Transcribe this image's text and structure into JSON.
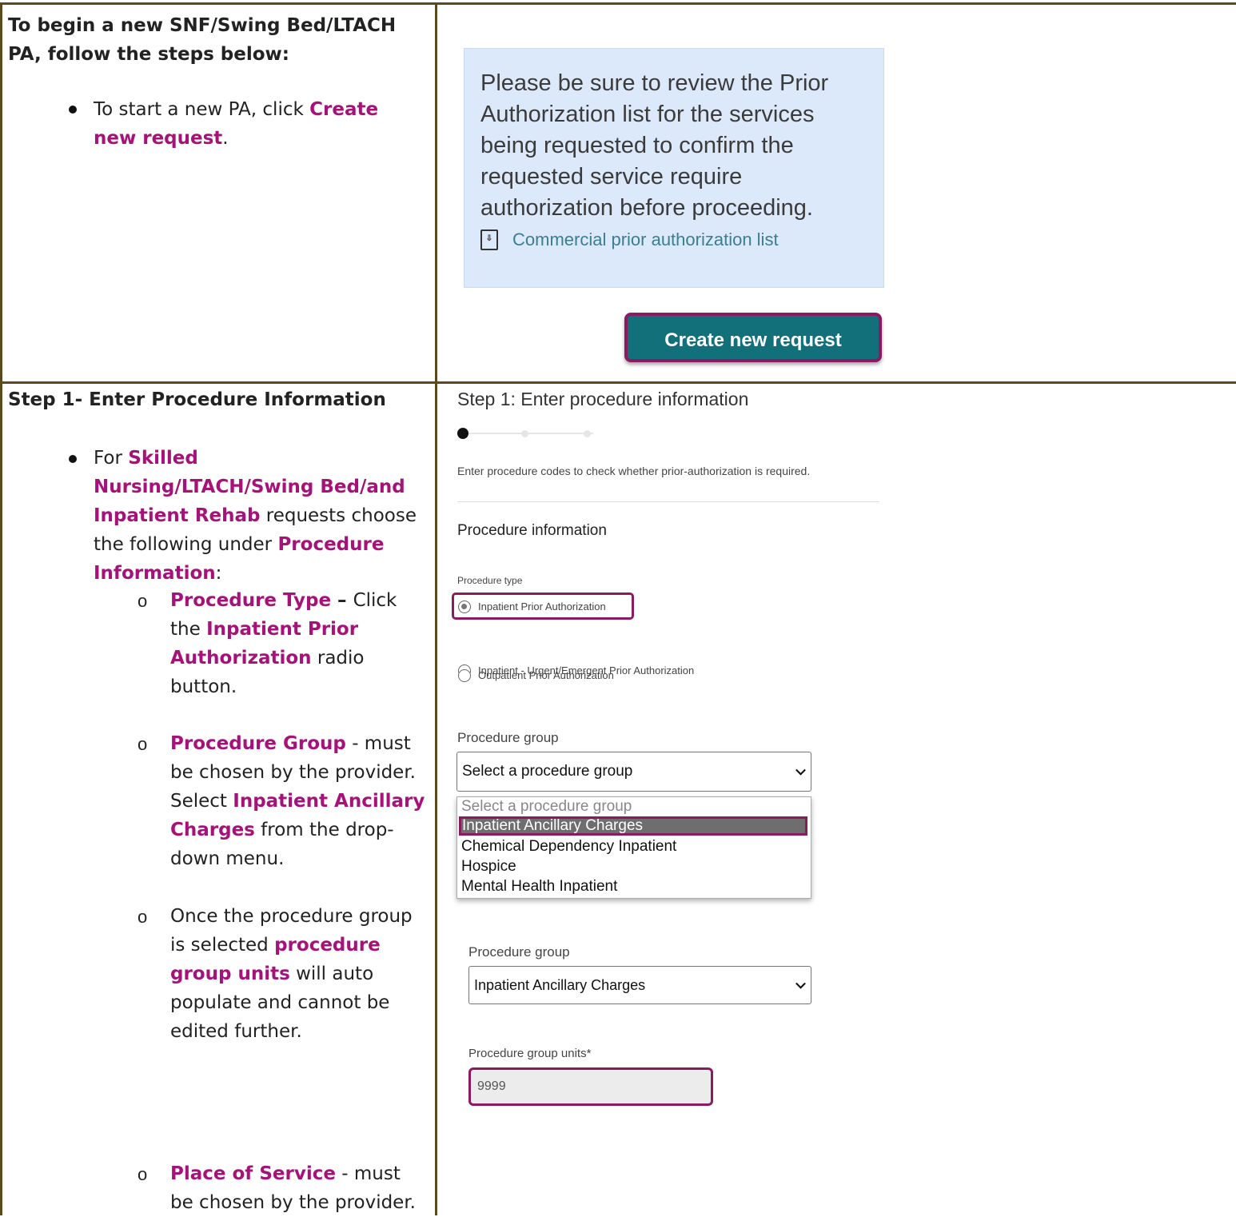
{
  "row1": {
    "heading": "To begin a new SNF/Swing Bed/LTACH PA, follow the steps below:",
    "bullet_text_pre": "To start a new PA, click ",
    "bullet_link": "Create new request",
    "bullet_text_post": "."
  },
  "notice": {
    "text": "Please be sure to review the Prior Authorization list for the services being requested to confirm the requested service require authorization before proceeding.",
    "link_label": "Commercial prior authorization list",
    "link_icon": "pdf-icon"
  },
  "create_button": {
    "label": "Create new request"
  },
  "row2": {
    "heading": "Step 1- Enter Procedure Information",
    "b1_pre": "For ",
    "b1_mag": "Skilled Nursing/LTACH/Swing Bed/and Inpatient Rehab",
    "b1_mid": " requests choose the following under ",
    "b1_mag2": "Procedure Information",
    "b1_post": ":",
    "s1_mag": "Procedure Type",
    "s1_dash": " – ",
    "s1_t1": "Click the ",
    "s1_mag2": "Inpatient Prior Authorization",
    "s1_t2": " radio button.",
    "s2_mag": "Procedure Group",
    "s2_t1": " - must be chosen by the provider. Select ",
    "s2_mag2": "Inpatient Ancillary Charges",
    "s2_t2": " from the drop-down menu.",
    "s3_t1": "Once the procedure group is selected ",
    "s3_mag": "procedure group units",
    "s3_t2": " will auto populate and cannot be edited further.",
    "s4_mag": "Place of Service",
    "s4_t1": " - must be chosen by the provider."
  },
  "step1": {
    "title": "Step 1: Enter procedure information",
    "help": "Enter procedure codes to check whether prior-authorization is required.",
    "section": "Procedure information",
    "type_label": "Procedure type",
    "radio_options": [
      "Inpatient Prior Authorization",
      "Inpatient - Urgent/Emergent Prior Authorization",
      "Outpatient Prior Authorization"
    ],
    "radio_selected": "Inpatient Prior Authorization",
    "group_label": "Procedure group",
    "group_placeholder": "Select a procedure group",
    "dropdown_options": [
      "Select a procedure group",
      "Inpatient Ancillary Charges",
      "Chemical Dependency Inpatient",
      "Hospice",
      "Mental Health Inpatient"
    ],
    "dropdown_highlighted": "Inpatient Ancillary Charges",
    "group_label2": "Procedure group",
    "group_selected": "Inpatient Ancillary Charges",
    "units_label": "Procedure group units*",
    "units_value": "9999"
  },
  "colors": {
    "accent": "#a6127a",
    "border": "#5a4a1c",
    "button": "#12707a",
    "highlight_border": "#8b1a63",
    "notice_bg": "#dce9fb"
  }
}
